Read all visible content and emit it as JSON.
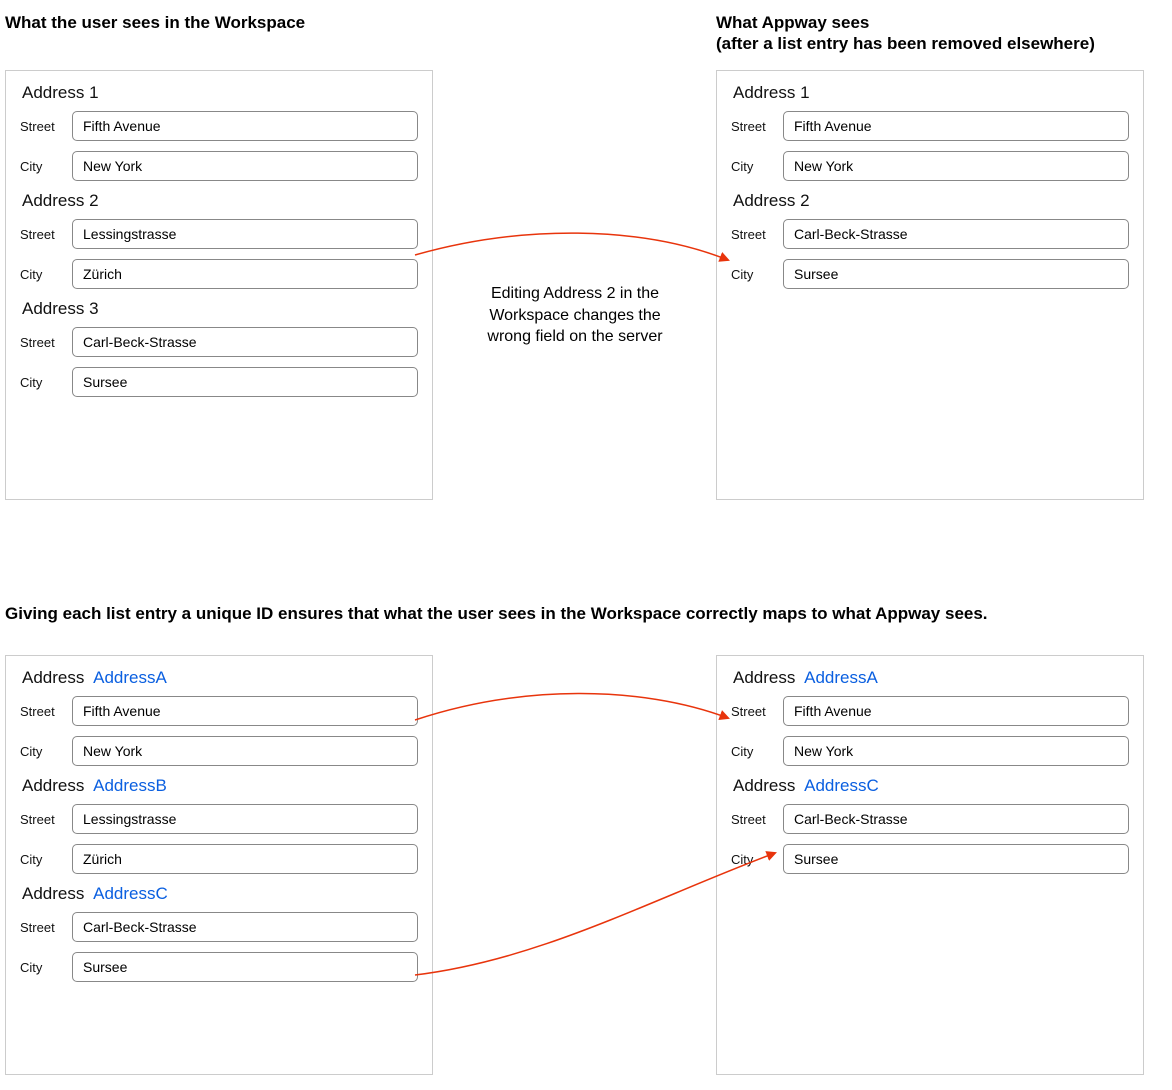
{
  "headings": {
    "left": "What the user sees in the Workspace",
    "right_line1": "What Appway sees",
    "right_line2": "(after a list entry has been removed elsewhere)",
    "middle": "Giving each list entry a unique ID ensures that what the user sees in the Workspace correctly maps to what Appway sees."
  },
  "labels": {
    "street": "Street",
    "city": "City",
    "address_word": "Address"
  },
  "caption": {
    "line1": "Editing Address 2 in the",
    "line2": "Workspace changes the",
    "line3": "wrong field on the server"
  },
  "top_left": {
    "items": [
      {
        "title": "Address 1",
        "street": "Fifth Avenue",
        "city": "New York"
      },
      {
        "title": "Address 2",
        "street": "Lessingstrasse",
        "city": "Zürich"
      },
      {
        "title": "Address 3",
        "street": "Carl-Beck-Strasse",
        "city": "Sursee"
      }
    ]
  },
  "top_right": {
    "items": [
      {
        "title": "Address 1",
        "street": "Fifth Avenue",
        "city": "New York"
      },
      {
        "title": "Address 2",
        "street": "Carl-Beck-Strasse",
        "city": "Sursee"
      }
    ]
  },
  "bottom_left": {
    "items": [
      {
        "id": "AddressA",
        "street": "Fifth Avenue",
        "city": "New York"
      },
      {
        "id": "AddressB",
        "street": "Lessingstrasse",
        "city": "Zürich"
      },
      {
        "id": "AddressC",
        "street": "Carl-Beck-Strasse",
        "city": "Sursee"
      }
    ]
  },
  "bottom_right": {
    "items": [
      {
        "id": "AddressA",
        "street": "Fifth Avenue",
        "city": "New York"
      },
      {
        "id": "AddressC",
        "street": "Carl-Beck-Strasse",
        "city": "Sursee"
      }
    ]
  },
  "colors": {
    "arrow": "#e8340c",
    "id_blue": "#0a5fe0"
  }
}
